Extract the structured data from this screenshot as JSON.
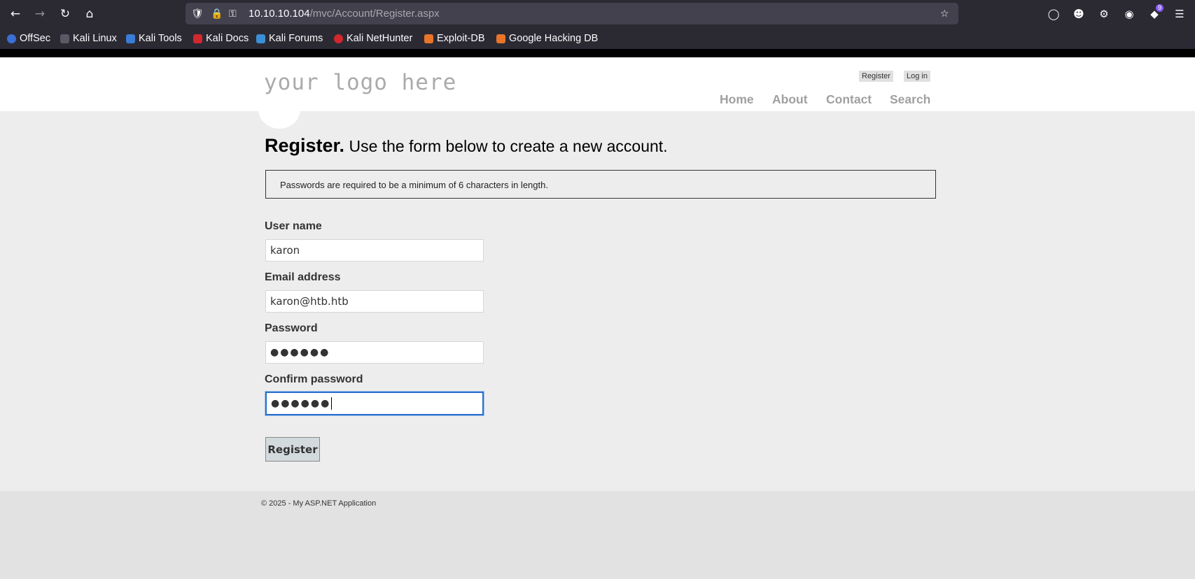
{
  "browser": {
    "url_host": "10.10.10.104",
    "url_path": "/mvc/Account/Register.aspx",
    "extension_badge": "9",
    "bookmarks": [
      "OffSec",
      "Kali Linux",
      "Kali Tools",
      "Kali Docs",
      "Kali Forums",
      "Kali NetHunter",
      "Exploit-DB",
      "Google Hacking DB"
    ]
  },
  "site": {
    "logo": "your logo here",
    "register_link": "Register",
    "login_link": "Log in",
    "nav": [
      "Home",
      "About",
      "Contact",
      "Search"
    ]
  },
  "page": {
    "title_bold": "Register.",
    "title_rest": "Use the form below to create a new account.",
    "notice": "Passwords are required to be a minimum of 6 characters in length."
  },
  "form": {
    "username_label": "User name",
    "username_value": "karon",
    "email_label": "Email address",
    "email_value": "karon@htb.htb",
    "password_label": "Password",
    "password_mask": "●●●●●●",
    "confirm_label": "Confirm password",
    "confirm_mask": "●●●●●●",
    "submit_label": "Register"
  },
  "footer": {
    "text": "© 2025 - My ASP.NET Application"
  },
  "colors": {
    "chrome_bg": "#2b2a33",
    "focus_border": "#2a6fcc",
    "page_bg": "#ededed"
  }
}
